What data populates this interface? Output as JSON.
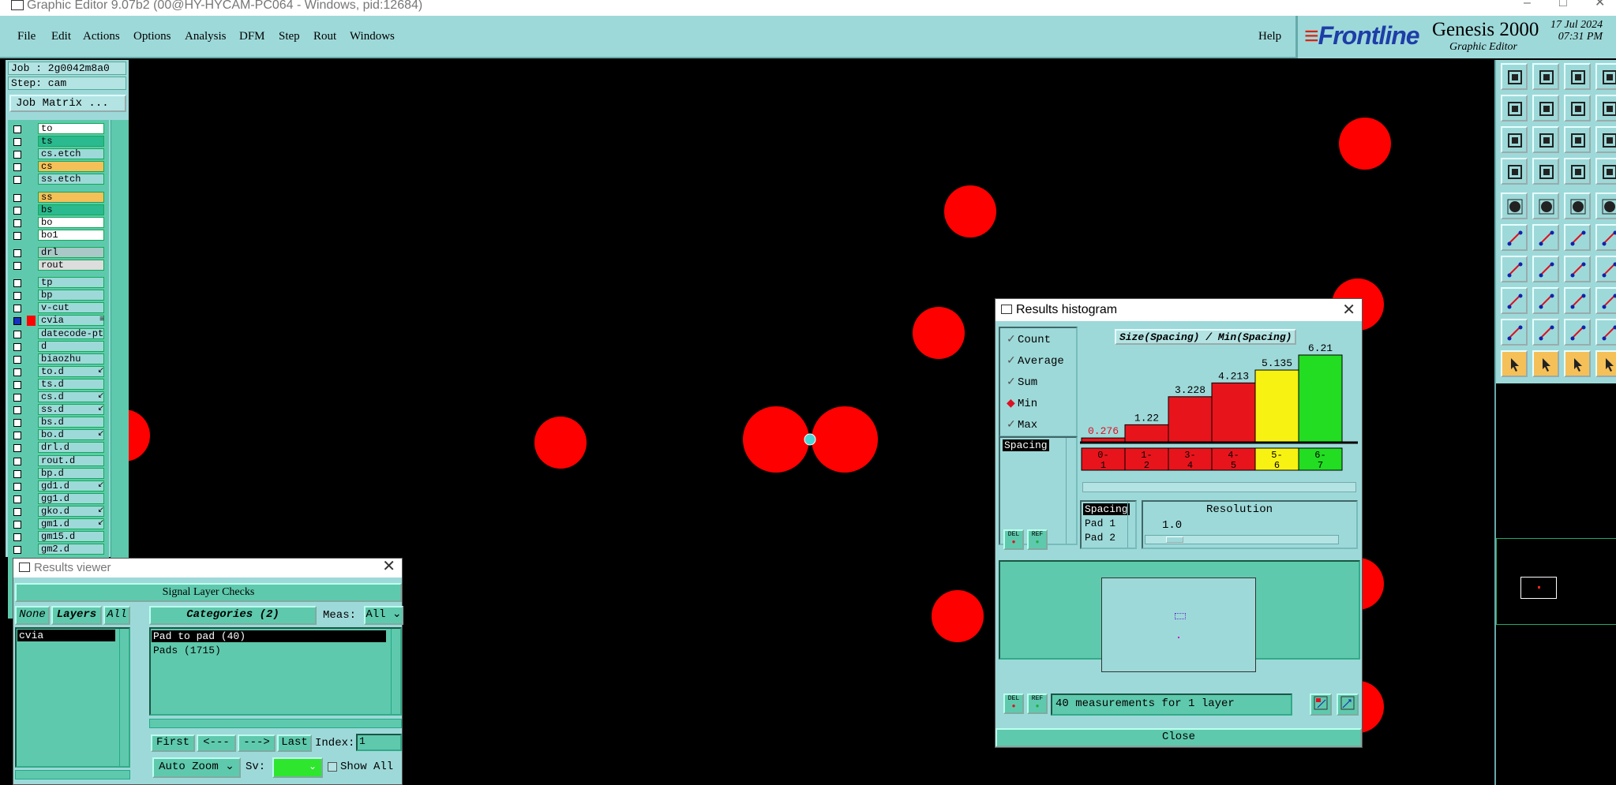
{
  "window": {
    "title": "Graphic Editor 9.07b2 (00@HY-HYCAM-PC064 - Windows, pid:12684)",
    "controls": [
      "–",
      "□",
      "✕"
    ]
  },
  "menu": {
    "items": [
      "File",
      "Edit",
      "Actions",
      "Options",
      "Analysis",
      "DFM",
      "Step",
      "Rout",
      "Windows"
    ],
    "help": "Help"
  },
  "branding": {
    "logo": "Frontline",
    "product": "Genesis 2000",
    "subtitle": "Graphic Editor",
    "date": "17 Jul 2024",
    "time": "07:31 PM"
  },
  "job": {
    "job_label": "Job : 2g0042m8a0",
    "step_label": "Step: cam",
    "matrix_button": "Job Matrix ..."
  },
  "layers": [
    {
      "name": "to",
      "color": "#ffffff",
      "mark": ""
    },
    {
      "name": "ts",
      "color": "#2bb98f",
      "mark": ""
    },
    {
      "name": "cs.etch",
      "color": "#9ed9d9",
      "mark": ""
    },
    {
      "name": "cs",
      "color": "#f5c058",
      "mark": ""
    },
    {
      "name": "ss.etch",
      "color": "#9ed9d9",
      "mark": ""
    },
    {
      "name": "ss",
      "color": "#f5c058",
      "mark": ""
    },
    {
      "name": "bs",
      "color": "#2bb98f",
      "mark": ""
    },
    {
      "name": "bo",
      "color": "#ffffff",
      "mark": ""
    },
    {
      "name": "bo1",
      "color": "#ffffff",
      "mark": ""
    },
    {
      "name": "drl",
      "color": "#aac8c8",
      "mark": ""
    },
    {
      "name": "rout",
      "color": "#dddddd",
      "mark": ""
    },
    {
      "name": "tp",
      "color": "#9ed9d9",
      "mark": ""
    },
    {
      "name": "bp",
      "color": "#9ed9d9",
      "mark": ""
    },
    {
      "name": "v-cut",
      "color": "#9ed9d9",
      "mark": ""
    },
    {
      "name": "cvia",
      "color": "#9ed9d9",
      "mark": "≡"
    },
    {
      "name": "datecode-pte",
      "color": "#9ed9d9",
      "mark": ""
    },
    {
      "name": "d",
      "color": "#9ed9d9",
      "mark": ""
    },
    {
      "name": "biaozhu",
      "color": "#9ed9d9",
      "mark": ""
    },
    {
      "name": "to.d",
      "color": "#9ed9d9",
      "mark": "↙"
    },
    {
      "name": "ts.d",
      "color": "#9ed9d9",
      "mark": ""
    },
    {
      "name": "cs.d",
      "color": "#9ed9d9",
      "mark": "↙"
    },
    {
      "name": "ss.d",
      "color": "#9ed9d9",
      "mark": "↙"
    },
    {
      "name": "bs.d",
      "color": "#9ed9d9",
      "mark": ""
    },
    {
      "name": "bo.d",
      "color": "#9ed9d9",
      "mark": "↙"
    },
    {
      "name": "drl.d",
      "color": "#9ed9d9",
      "mark": ""
    },
    {
      "name": "rout.d",
      "color": "#9ed9d9",
      "mark": ""
    },
    {
      "name": "bp.d",
      "color": "#9ed9d9",
      "mark": ""
    },
    {
      "name": "gd1.d",
      "color": "#9ed9d9",
      "mark": "↙"
    },
    {
      "name": "gg1.d",
      "color": "#9ed9d9",
      "mark": ""
    },
    {
      "name": "gko.d",
      "color": "#9ed9d9",
      "mark": "↙"
    },
    {
      "name": "gm1.d",
      "color": "#9ed9d9",
      "mark": "↙"
    },
    {
      "name": "gm15.d",
      "color": "#9ed9d9",
      "mark": ""
    },
    {
      "name": "gm2.d",
      "color": "#9ed9d9",
      "mark": ""
    }
  ],
  "histogram": {
    "title": "Results histogram",
    "chart_title": "Size(Spacing) / Min(Spacing)",
    "options": [
      {
        "label": "Count",
        "kind": "check"
      },
      {
        "label": "Average",
        "kind": "check"
      },
      {
        "label": "Sum",
        "kind": "check"
      },
      {
        "label": "Min",
        "kind": "diamond"
      },
      {
        "label": "Max",
        "kind": "check"
      }
    ],
    "category_list": [
      "Spacing"
    ],
    "bins": [
      {
        "label": "0-\n1",
        "value": "0.276",
        "color": "#e8141c"
      },
      {
        "label": "1-\n2",
        "value": "1.22",
        "color": "#e8141c"
      },
      {
        "label": "3-\n4",
        "value": "3.228",
        "color": "#e8141c"
      },
      {
        "label": "4-\n5",
        "value": "4.213",
        "color": "#e8141c"
      },
      {
        "label": "5-\n6",
        "value": "5.135",
        "color": "#f8f212"
      },
      {
        "label": "6-\n7",
        "value": "6.21",
        "color": "#22dd22"
      }
    ],
    "meas_list": [
      "Spacing",
      "Pad 1",
      "Pad 2"
    ],
    "resolution_label": "Resolution",
    "resolution_value": "1.0",
    "del_label": "DEL",
    "ref_label": "REF",
    "status": "40 measurements for 1 layer",
    "close_label": "Close"
  },
  "results_viewer": {
    "title": "Results viewer",
    "check_group": "Signal Layer Checks",
    "none_label": "None",
    "layers_label": "Layers",
    "all_label": "All",
    "categories_label": "Categories (2)",
    "meas_label": "Meas:",
    "meas_value": "All",
    "layer_items": [
      "cvia"
    ],
    "category_items": [
      "Pad to pad (40)",
      "Pads (1715)"
    ],
    "first_label": "First",
    "prev_label": "<---",
    "next_label": "--->",
    "last_label": "Last",
    "index_label": "Index:",
    "index_value": "1",
    "autozoom_label": "Auto Zoom",
    "sv_label": "Sv:",
    "show_all_label": "Show All"
  },
  "colors": {
    "panel": "#9ed9d9",
    "panel_green": "#5fc9ad",
    "pad": "#ff0000",
    "canvas": "#000000"
  }
}
